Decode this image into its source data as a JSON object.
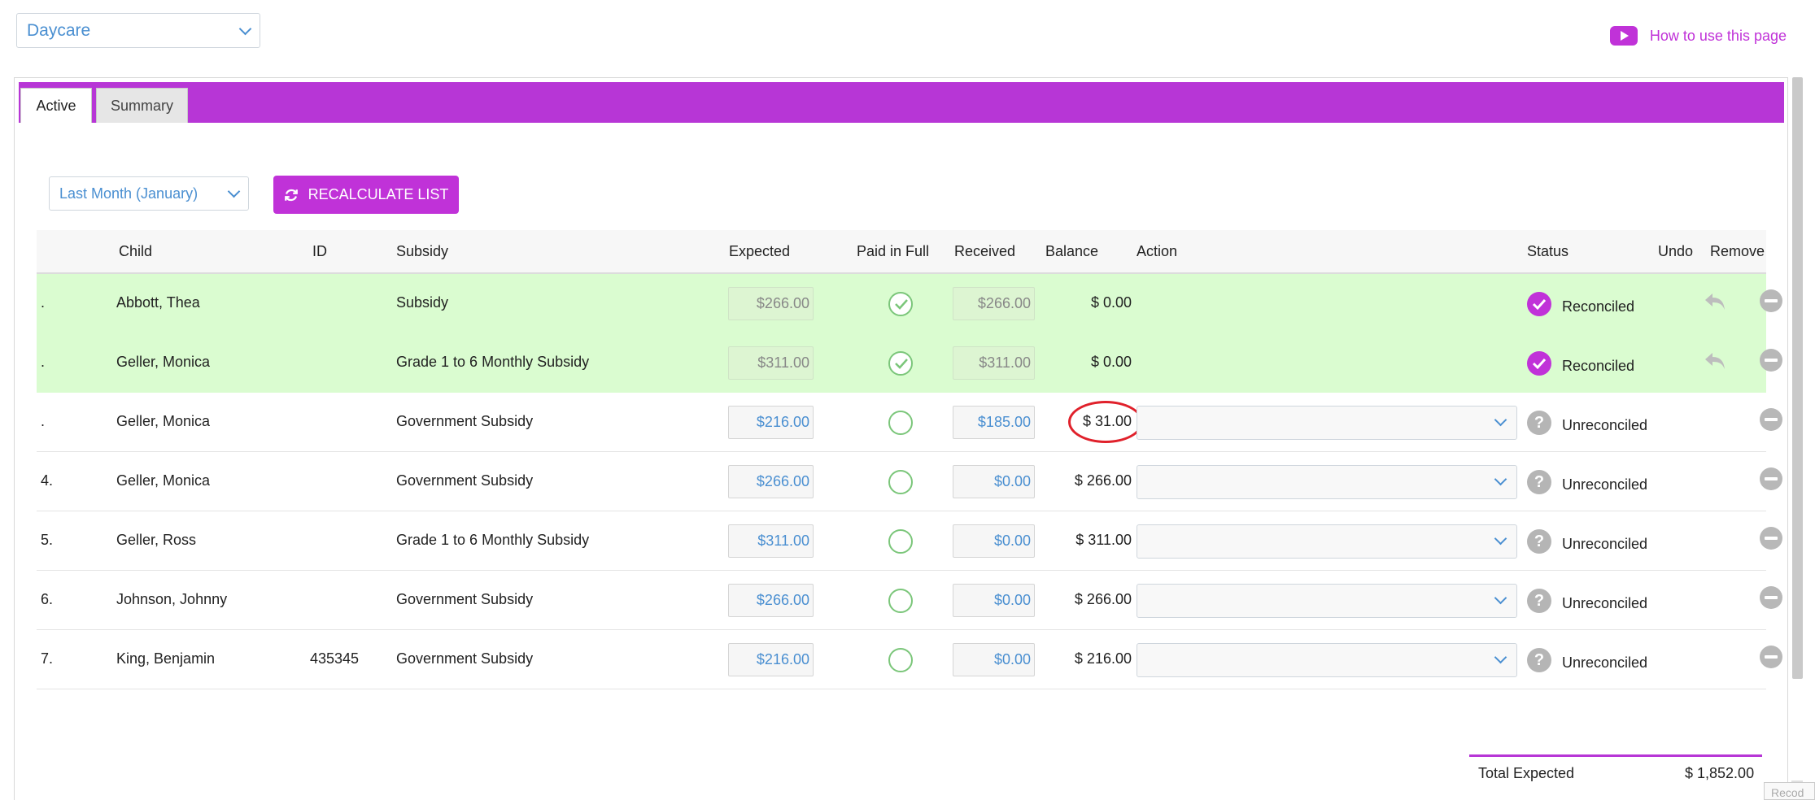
{
  "top": {
    "location_select": "Daycare",
    "howto_label": "How to use this page"
  },
  "tabs": [
    {
      "label": "Active"
    },
    {
      "label": "Summary"
    }
  ],
  "toolbar": {
    "period_select": "Last Month (January)",
    "recalculate_label": "RECALCULATE LIST"
  },
  "columns": {
    "child": "Child",
    "id": "ID",
    "subsidy": "Subsidy",
    "expected": "Expected",
    "paid": "Paid in Full",
    "received": "Received",
    "balance": "Balance",
    "action": "Action",
    "status": "Status",
    "undo": "Undo",
    "remove": "Remove"
  },
  "rows": [
    {
      "num": ".",
      "child": "Abbott, Thea",
      "id": "",
      "subsidy": "Subsidy",
      "expected": "$266.00",
      "paid": true,
      "received": "$266.00",
      "balance": "$ 0.00",
      "status": "Reconciled",
      "reconciled": true
    },
    {
      "num": ".",
      "child": "Geller, Monica",
      "id": "",
      "subsidy": "Grade 1 to 6 Monthly Subsidy",
      "expected": "$311.00",
      "paid": true,
      "received": "$311.00",
      "balance": "$ 0.00",
      "status": "Reconciled",
      "reconciled": true
    },
    {
      "num": ".",
      "child": "Geller, Monica",
      "id": "",
      "subsidy": "Government Subsidy",
      "expected": "$216.00",
      "paid": false,
      "received": "$185.00",
      "balance": "$ 31.00",
      "status": "Unreconciled",
      "reconciled": false
    },
    {
      "num": "4.",
      "child": "Geller, Monica",
      "id": "",
      "subsidy": "Government Subsidy",
      "expected": "$266.00",
      "paid": false,
      "received": "$0.00",
      "balance": "$ 266.00",
      "status": "Unreconciled",
      "reconciled": false
    },
    {
      "num": "5.",
      "child": "Geller, Ross",
      "id": "",
      "subsidy": "Grade 1 to 6 Monthly Subsidy",
      "expected": "$311.00",
      "paid": false,
      "received": "$0.00",
      "balance": "$ 311.00",
      "status": "Unreconciled",
      "reconciled": false
    },
    {
      "num": "6.",
      "child": "Johnson, Johnny",
      "id": "",
      "subsidy": "Government Subsidy",
      "expected": "$266.00",
      "paid": false,
      "received": "$0.00",
      "balance": "$ 266.00",
      "status": "Unreconciled",
      "reconciled": false
    },
    {
      "num": "7.",
      "child": "King, Benjamin",
      "id": "435345",
      "subsidy": "Government Subsidy",
      "expected": "$216.00",
      "paid": false,
      "received": "$0.00",
      "balance": "$ 216.00",
      "status": "Unreconciled",
      "reconciled": false
    }
  ],
  "totals": {
    "expected_label": "Total Expected",
    "expected_value": "$ 1,852.00"
  },
  "corner_text": "Recod",
  "colors": {
    "accent": "#b736d6",
    "link": "#4a8fd1",
    "reconciled_row": "#dafcd0",
    "highlight": "#e0212b"
  }
}
